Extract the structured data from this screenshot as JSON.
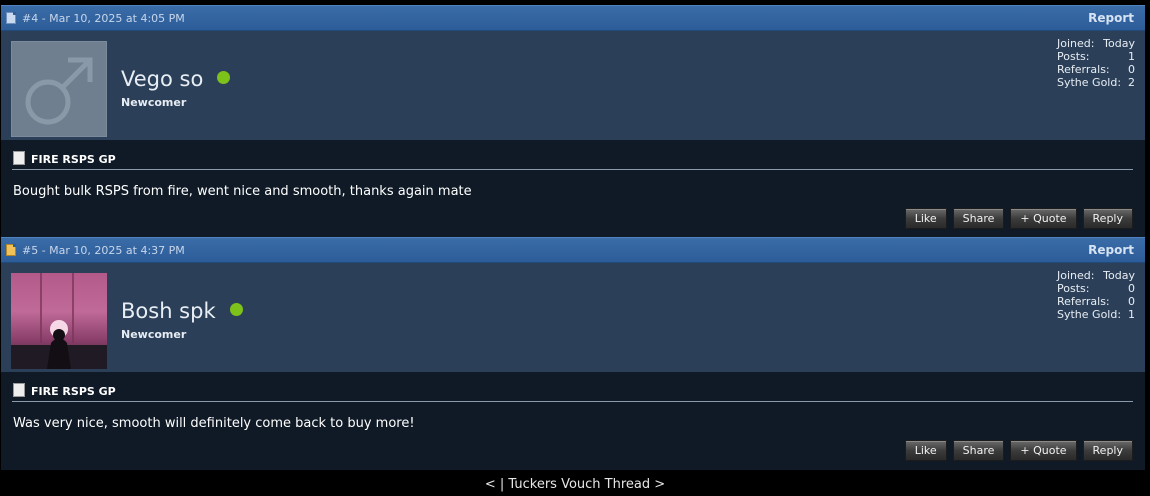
{
  "posts": [
    {
      "header": "#4 - Mar 10, 2025 at 4:05 PM",
      "report": "Report",
      "username": "Vego so",
      "rank": "Newcomer",
      "stats": [
        {
          "label": "Joined:",
          "value": "Today"
        },
        {
          "label": "Posts:",
          "value": "1"
        },
        {
          "label": "Referrals:",
          "value": "0"
        },
        {
          "label": "Sythe Gold:",
          "value": "2"
        }
      ],
      "title": "FIRE RSPS GP",
      "message": "Bought bulk RSPS from fire, went nice and smooth, thanks again mate",
      "buttons": {
        "like": "Like",
        "share": "Share",
        "quote": "+ Quote",
        "reply": "Reply"
      }
    },
    {
      "header": "#5 - Mar 10, 2025 at 4:37 PM",
      "report": "Report",
      "username": "Bosh spk",
      "rank": "Newcomer",
      "stats": [
        {
          "label": "Joined:",
          "value": "Today"
        },
        {
          "label": "Posts:",
          "value": "0"
        },
        {
          "label": "Referrals:",
          "value": "0"
        },
        {
          "label": "Sythe Gold:",
          "value": "1"
        }
      ],
      "title": "FIRE RSPS GP",
      "message": "Was very nice, smooth will definitely come back to buy more!",
      "buttons": {
        "like": "Like",
        "share": "Share",
        "quote": "+ Quote",
        "reply": "Reply"
      }
    }
  ],
  "footer": {
    "prev": "<",
    "sep": "|",
    "thread": "Tuckers Vouch Thread",
    "next": ">"
  }
}
